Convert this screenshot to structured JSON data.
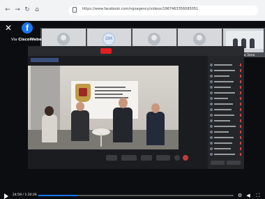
{
  "browser": {
    "url": "https://www.facebook.com/ngoagency/videos/1967463356085051",
    "back_icon": "back-arrow",
    "forward_icon": "forward-arrow",
    "reload_icon": "reload",
    "home_icon": "home"
  },
  "overlay": {
    "close_icon": "close",
    "logo_letter": "f",
    "via_prefix": "Via ",
    "via_app": "CiscoWebex"
  },
  "strip_participants": [
    {
      "name": "Пора Бичева",
      "initials": ""
    },
    {
      "name": "Dimo Marinov",
      "initials": "DM"
    },
    {
      "name": "Нено Ненов",
      "initials": ""
    },
    {
      "name": "К. Йорданов",
      "initials": ""
    },
    {
      "name": "Мрежови Зала",
      "initials": ""
    }
  ],
  "video": {
    "progress_fraction": 0.2,
    "time_text": "24:59 / 1:20:26",
    "accent": "#1877f2"
  }
}
